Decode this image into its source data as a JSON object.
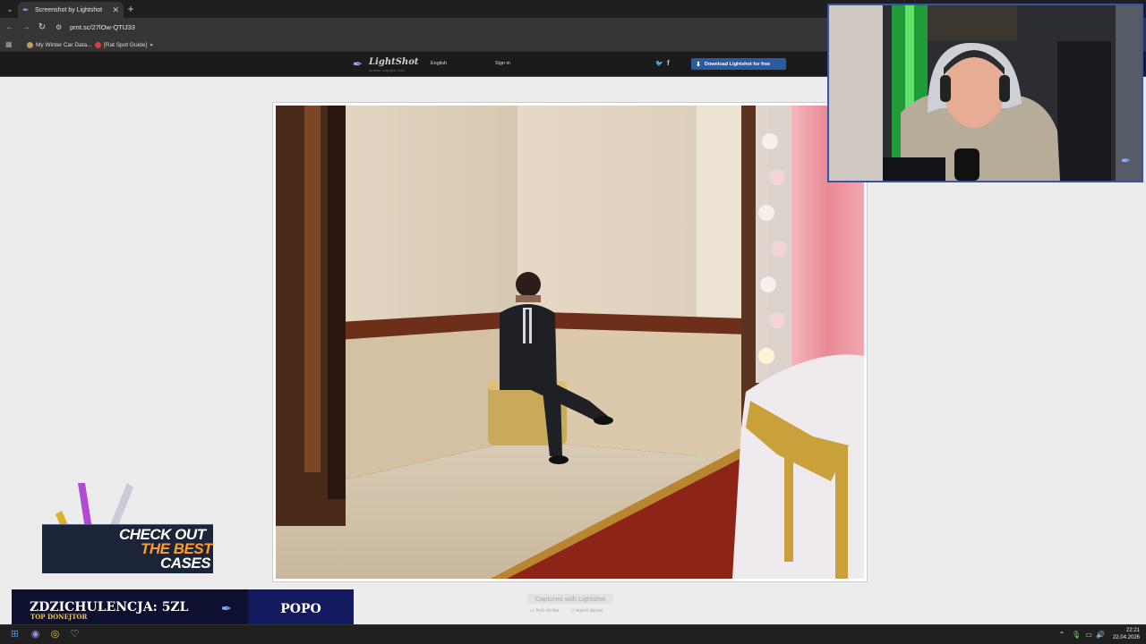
{
  "browser": {
    "tab_title": "Screenshot by Lightshot",
    "tab_close": "✕",
    "new_tab": "+",
    "url": "prnt.sc/27lOw-QTIJ33",
    "bookmarks": [
      {
        "label": "My Winter Car Data...",
        "color": "#c79a5a"
      },
      {
        "label": "[Rat Spot Guide]",
        "color": "#e03b3b"
      }
    ]
  },
  "lightshot": {
    "logo": "LightShot",
    "tagline": "screen capture tool",
    "language": "English",
    "signin": "Sign in",
    "download_label": "Download Lightshot for free",
    "captured_label": "Captured with Lightshot",
    "find_similar": "find similar",
    "report_abuse": "report abuse"
  },
  "overlay": {
    "ad_lines": [
      "CHECK OUT",
      "THE BEST",
      "CASES"
    ],
    "donor_amount": "ZDZICHULENCJA: 5ZL",
    "donor_label": "TOP DONEJTOR",
    "donor_name": "POPO"
  },
  "taskbar": {
    "time": "22:21",
    "date": "22.04.2026"
  },
  "colors": {
    "accent_blue": "#2c5a9e",
    "cam_border": "#3754a8",
    "ad_orange": "#ff9b2f",
    "donor_gold": "#f2c94c"
  }
}
